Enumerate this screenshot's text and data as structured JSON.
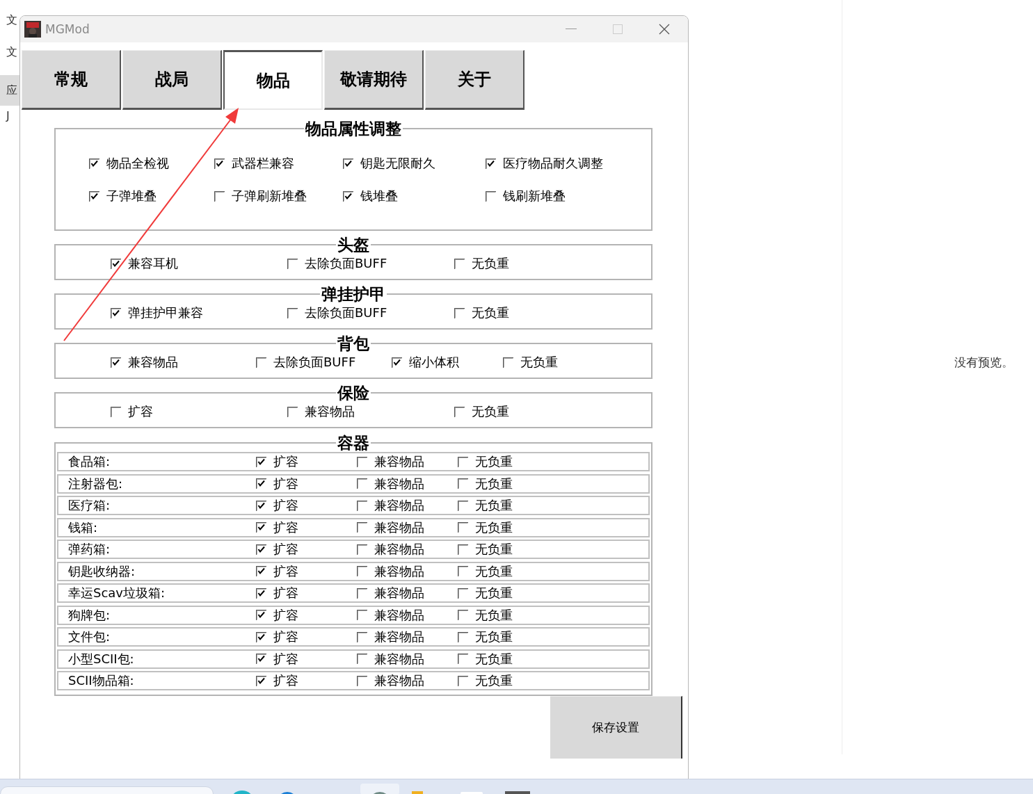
{
  "desktop_sidebar": {
    "items": [
      {
        "label": "文",
        "selected": false
      },
      {
        "label": "文",
        "selected": false
      },
      {
        "label": "应",
        "selected": true
      },
      {
        "label": "J",
        "selected": false
      }
    ]
  },
  "preview": {
    "text": "没有预览。"
  },
  "window": {
    "title": "MGMod"
  },
  "tabs": [
    {
      "label": "常规",
      "selected": false
    },
    {
      "label": "战局",
      "selected": false
    },
    {
      "label": "物品",
      "selected": true
    },
    {
      "label": "敬请期待",
      "selected": false
    },
    {
      "label": "关于",
      "selected": false
    }
  ],
  "sections": [
    {
      "title": "物品属性调整",
      "kind": "grid",
      "options": [
        {
          "label": "物品全检视",
          "checked": true
        },
        {
          "label": "武器栏兼容",
          "checked": true
        },
        {
          "label": "钥匙无限耐久",
          "checked": true
        },
        {
          "label": "医疗物品耐久调整",
          "checked": true
        },
        {
          "label": "子弹堆叠",
          "checked": true
        },
        {
          "label": "子弹刷新堆叠",
          "checked": false
        },
        {
          "label": "钱堆叠",
          "checked": true
        },
        {
          "label": "钱刷新堆叠",
          "checked": false
        }
      ]
    },
    {
      "title": "头盔",
      "kind": "row",
      "options": [
        {
          "label": "兼容耳机",
          "checked": true
        },
        {
          "label": "去除负面BUFF",
          "checked": false
        },
        {
          "label": "无负重",
          "checked": false
        }
      ]
    },
    {
      "title": "弹挂护甲",
      "kind": "row",
      "options": [
        {
          "label": "弹挂护甲兼容",
          "checked": true
        },
        {
          "label": "去除负面BUFF",
          "checked": false
        },
        {
          "label": "无负重",
          "checked": false
        }
      ]
    },
    {
      "title": "背包",
      "kind": "row",
      "options": [
        {
          "label": "兼容物品",
          "checked": true
        },
        {
          "label": "去除负面BUFF",
          "checked": false
        },
        {
          "label": "缩小体积",
          "checked": true
        },
        {
          "label": "无负重",
          "checked": false
        }
      ]
    },
    {
      "title": "保险",
      "kind": "row",
      "options": [
        {
          "label": "扩容",
          "checked": false
        },
        {
          "label": "兼容物品",
          "checked": false
        },
        {
          "label": "无负重",
          "checked": false
        }
      ]
    }
  ],
  "containers": {
    "title": "容器",
    "rows": [
      {
        "label": "食品箱:",
        "options": [
          {
            "label": "扩容",
            "checked": true
          },
          {
            "label": "兼容物品",
            "checked": false
          },
          {
            "label": "无负重",
            "checked": false
          }
        ]
      },
      {
        "label": "注射器包:",
        "options": [
          {
            "label": "扩容",
            "checked": true
          },
          {
            "label": "兼容物品",
            "checked": false
          },
          {
            "label": "无负重",
            "checked": false
          }
        ]
      },
      {
        "label": "医疗箱:",
        "options": [
          {
            "label": "扩容",
            "checked": true
          },
          {
            "label": "兼容物品",
            "checked": false
          },
          {
            "label": "无负重",
            "checked": false
          }
        ]
      },
      {
        "label": "钱箱:",
        "options": [
          {
            "label": "扩容",
            "checked": true
          },
          {
            "label": "兼容物品",
            "checked": false
          },
          {
            "label": "无负重",
            "checked": false
          }
        ]
      },
      {
        "label": "弹药箱:",
        "options": [
          {
            "label": "扩容",
            "checked": true
          },
          {
            "label": "兼容物品",
            "checked": false
          },
          {
            "label": "无负重",
            "checked": false
          }
        ]
      },
      {
        "label": "钥匙收纳器:",
        "options": [
          {
            "label": "扩容",
            "checked": true
          },
          {
            "label": "兼容物品",
            "checked": false
          },
          {
            "label": "无负重",
            "checked": false
          }
        ]
      },
      {
        "label": "幸运Scav垃圾箱:",
        "options": [
          {
            "label": "扩容",
            "checked": true
          },
          {
            "label": "兼容物品",
            "checked": false
          },
          {
            "label": "无负重",
            "checked": false
          }
        ]
      },
      {
        "label": "狗牌包:",
        "options": [
          {
            "label": "扩容",
            "checked": true
          },
          {
            "label": "兼容物品",
            "checked": false
          },
          {
            "label": "无负重",
            "checked": false
          }
        ]
      },
      {
        "label": "文件包:",
        "options": [
          {
            "label": "扩容",
            "checked": true
          },
          {
            "label": "兼容物品",
            "checked": false
          },
          {
            "label": "无负重",
            "checked": false
          }
        ]
      },
      {
        "label": "小型SCII包:",
        "options": [
          {
            "label": "扩容",
            "checked": true
          },
          {
            "label": "兼容物品",
            "checked": false
          },
          {
            "label": "无负重",
            "checked": false
          }
        ]
      },
      {
        "label": "SCII物品箱:",
        "options": [
          {
            "label": "扩容",
            "checked": true
          },
          {
            "label": "兼容物品",
            "checked": false
          },
          {
            "label": "无负重",
            "checked": false
          }
        ]
      }
    ]
  },
  "save_button": "保存设置"
}
